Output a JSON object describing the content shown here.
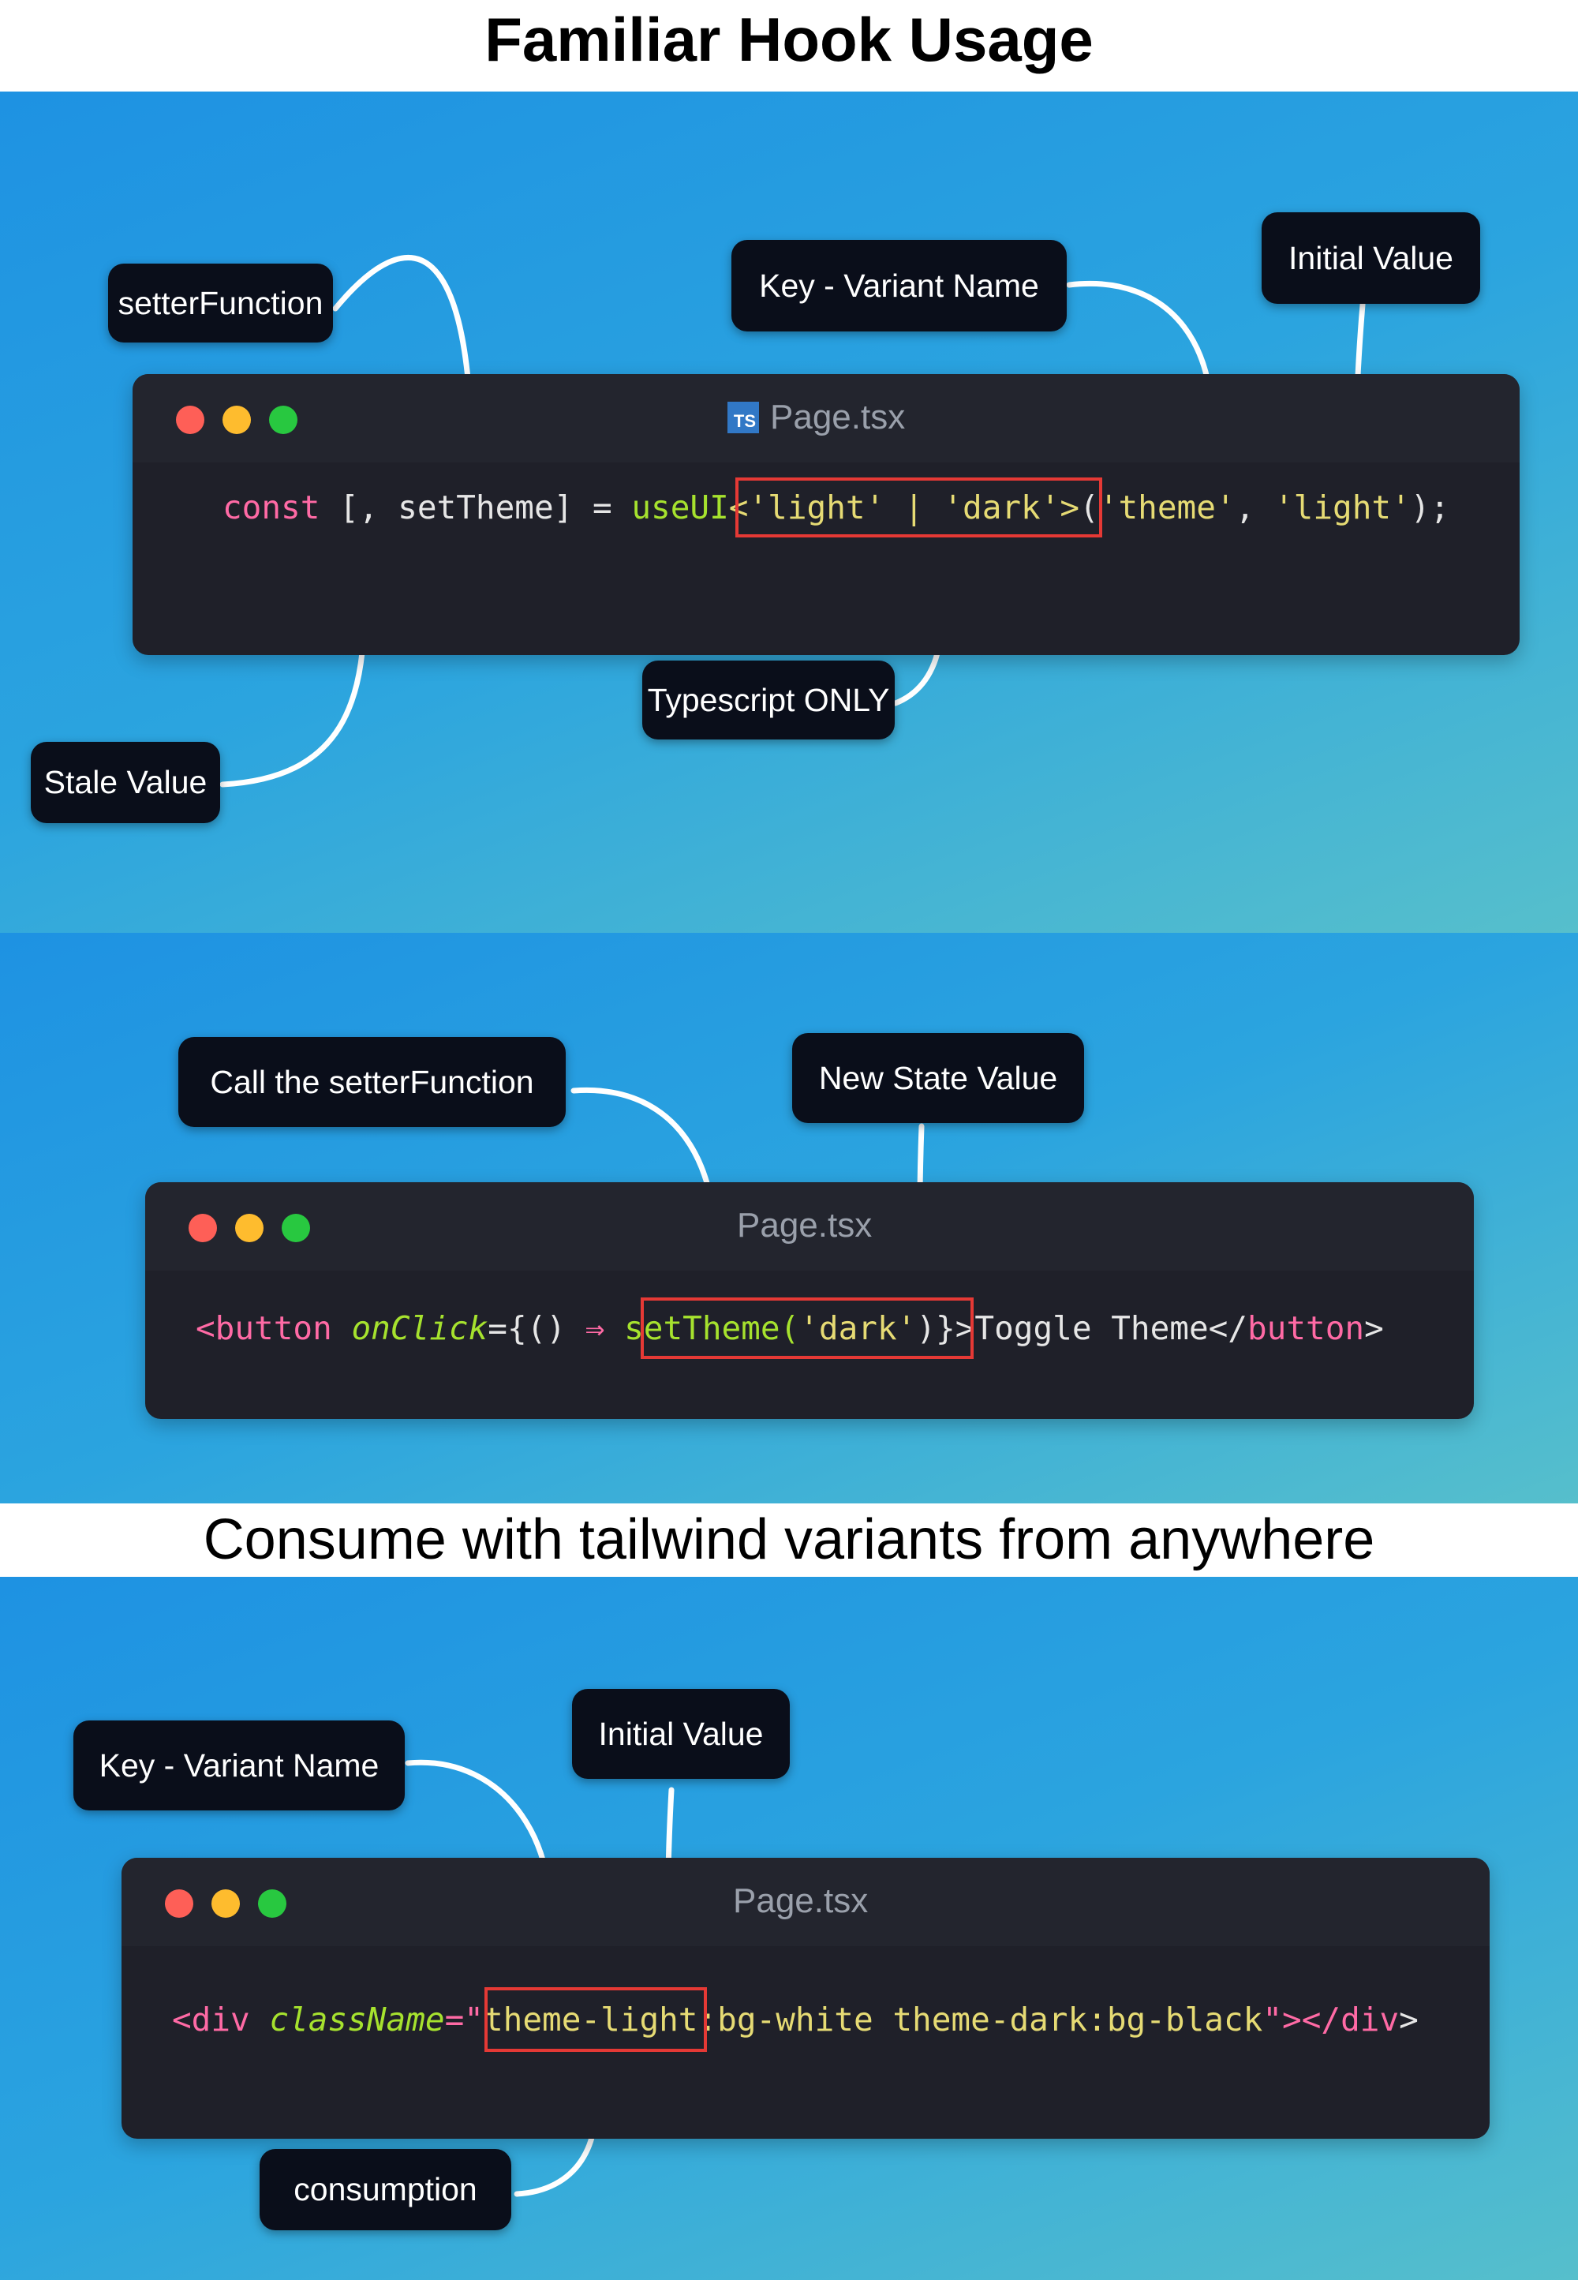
{
  "headings": {
    "hook_usage": "Familiar Hook Usage",
    "consume": "Consume with tailwind variants from anywhere"
  },
  "window": {
    "filename": "Page.tsx",
    "ts_badge": "TS"
  },
  "panel1": {
    "code": {
      "kw_const": "const",
      "destructure": " [, setTheme] = ",
      "fn_name": "useUI",
      "generic": "<'light' | 'dark'>",
      "open_paren": "(",
      "arg_key": "'theme'",
      "comma": ", ",
      "arg_init": "'light'",
      "close": ");"
    },
    "callouts": {
      "setter": "setterFunction",
      "key": "Key - Variant Name",
      "initial": "Initial Value",
      "ts_only": "Typescript ONLY",
      "stale": "Stale Value"
    }
  },
  "panel2": {
    "code": {
      "tag_open": "<button",
      "attr": " onClick",
      "eq_brace": "={() ",
      "arrow": "⇒",
      "space": " ",
      "call_fn": "setTheme(",
      "call_arg": "'dark'",
      "call_close": ")",
      "after": "}>Toggle Theme</",
      "tag_close": "button",
      "gt": ">"
    },
    "callouts": {
      "call": "Call the setterFunction",
      "new_state": "New State Value"
    }
  },
  "panel3": {
    "code": {
      "tag_open": "<div",
      "attr": " className",
      "eq_quote": "=\"",
      "class_value": "theme-light:bg-white theme-dark:bg-black",
      "end_quote": "\"></",
      "tag_close": "div",
      "gt": ">"
    },
    "callouts": {
      "key": "Key - Variant Name",
      "initial": "Initial Value",
      "consumption": "consumption"
    }
  }
}
